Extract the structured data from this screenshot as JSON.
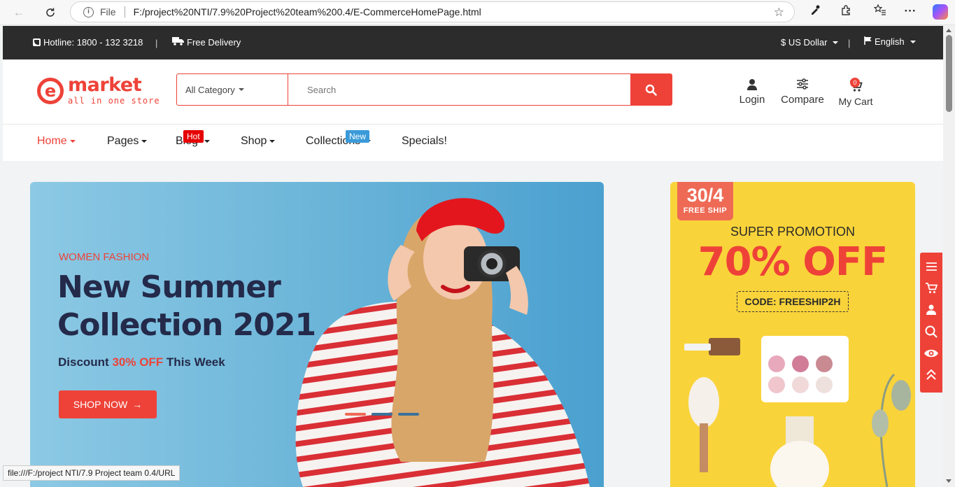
{
  "browser": {
    "protocol_label": "File",
    "url": "F:/project%20NTI/7.9%20Project%20team%200.4/E-CommerceHomePage.html",
    "status_url": "file:///F:/project NTI/7.9 Project team 0.4/URL"
  },
  "topbar": {
    "hotline": "Hotline: 1800 - 132 3218",
    "delivery": "Free Delivery",
    "currency": "$ US Dollar",
    "language": "English"
  },
  "logo": {
    "name": "market",
    "tagline": "all in one store"
  },
  "search": {
    "category": "All Category",
    "placeholder": "Search"
  },
  "actions": {
    "login": "Login",
    "compare": "Compare",
    "cart": "My Cart",
    "cart_count": "0"
  },
  "menu": {
    "home": "Home",
    "pages": "Pages",
    "blog": "Blog",
    "blog_label": "Hot",
    "shop": "Shop",
    "collections": "Collections",
    "collections_label": "New",
    "specials": "Specials!"
  },
  "hero": {
    "eyebrow": "WOMEN FASHION",
    "line1": "New Summer",
    "line2": "Collection 2021",
    "discount_pre": "Discount ",
    "discount_hl": "30% OFF",
    "discount_post": " This Week",
    "button": "SHOP NOW"
  },
  "promo": {
    "date": "30/4",
    "ship": "FREE SHIP",
    "super": "SUPER PROMOTION",
    "percent": "70% OFF",
    "code": "CODE: FREESHIP2H"
  },
  "colors": {
    "accent": "#ee4238",
    "topbar": "#2c2c2c",
    "hero_bg": "#6fb7da",
    "promo_bg": "#f9d33a",
    "hot": "#e50000",
    "new": "#3a9ad9"
  }
}
